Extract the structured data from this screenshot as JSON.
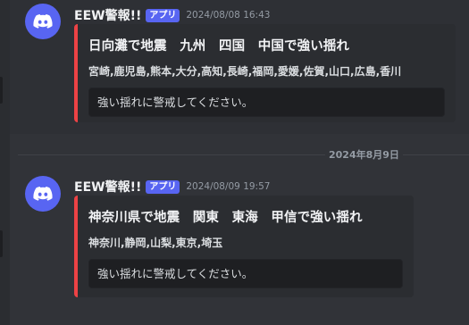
{
  "messages": [
    {
      "username": "EEW警報!!",
      "tag": "アプリ",
      "timestamp": "2024/08/08 16:43",
      "embed": {
        "title": "日向灘で地震　九州　四国　中国で強い揺れ",
        "regions": "宮崎,鹿児島,熊本,大分,高知,長崎,福岡,愛媛,佐賀,山口,広島,香川",
        "code": "強い揺れに警戒してください。",
        "accent_color": "#ed4245"
      }
    },
    {
      "username": "EEW警報!!",
      "tag": "アプリ",
      "timestamp": "2024/08/09 19:57",
      "embed": {
        "title": "神奈川県で地震　関東　東海　甲信で強い揺れ",
        "regions": "神奈川,静岡,山梨,東京,埼玉",
        "code": "強い揺れに警戒してください。",
        "accent_color": "#ed4245"
      }
    }
  ],
  "date_divider": "2024年8月9日",
  "icons": {
    "avatar": "discord-logo-icon"
  },
  "colors": {
    "background": "#313338",
    "brand": "#5865f2",
    "embed_border": "#ed4245"
  }
}
